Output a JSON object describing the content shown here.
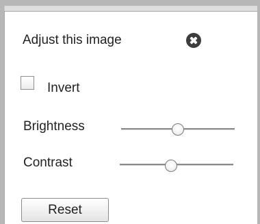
{
  "dialog": {
    "title": "Adjust this image",
    "close_icon": "close-circle-icon"
  },
  "invert": {
    "label": "Invert",
    "checked": false
  },
  "brightness": {
    "label": "Brightness",
    "level": 0.5
  },
  "contrast": {
    "label": "Contrast",
    "level": 0.45
  },
  "reset": {
    "label": "Reset"
  }
}
